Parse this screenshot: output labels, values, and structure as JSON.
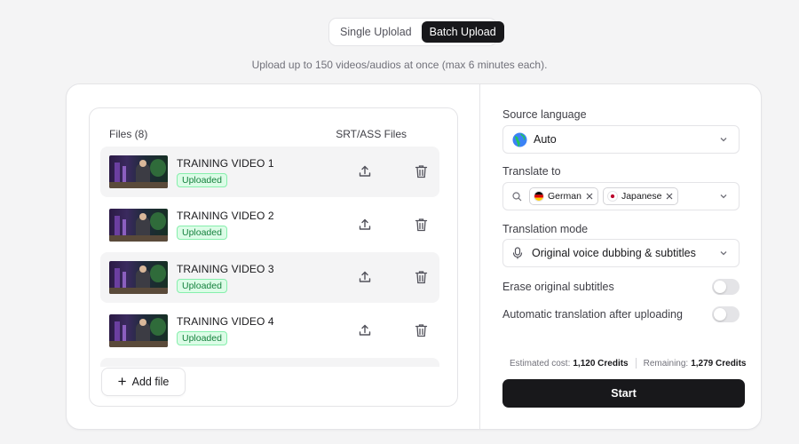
{
  "mode_toggle": {
    "single_label": "Single Uplolad",
    "batch_label": "Batch Upload",
    "active": "batch"
  },
  "subtitle": "Upload up to 150 videos/audios at once (max 6 minutes each).",
  "files": {
    "header": "Files (8)",
    "srt_header": "SRT/ASS Files",
    "items": [
      {
        "name": "TRAINING VIDEO 1",
        "status": "Uploaded"
      },
      {
        "name": "TRAINING VIDEO 2",
        "status": "Uploaded"
      },
      {
        "name": "TRAINING VIDEO 3",
        "status": "Uploaded"
      },
      {
        "name": "TRAINING VIDEO 4",
        "status": "Uploaded"
      }
    ],
    "add_file_label": "Add file"
  },
  "settings": {
    "source_language_label": "Source language",
    "source_language_value": "Auto",
    "translate_to_label": "Translate to",
    "target_languages": [
      "German",
      "Japanese"
    ],
    "translation_mode_label": "Translation mode",
    "translation_mode_value": "Original voice dubbing & subtitles",
    "erase_subtitles_label": "Erase original subtitles",
    "erase_subtitles_on": false,
    "auto_translate_label": "Automatic translation after uploading",
    "auto_translate_on": false
  },
  "cost": {
    "estimated_label": "Estimated cost:",
    "estimated_value": "1,120 Credits",
    "remaining_label": "Remaining:",
    "remaining_value": "1,279 Credits"
  },
  "start_label": "Start",
  "colors": {
    "accent": "#18181b",
    "success_text": "#15803d",
    "success_bg": "#dcfce7"
  },
  "icons": [
    "globe-icon",
    "search-icon",
    "microphone-icon",
    "upload-icon",
    "trash-icon",
    "chevron-down-icon",
    "close-icon",
    "plus-icon"
  ]
}
